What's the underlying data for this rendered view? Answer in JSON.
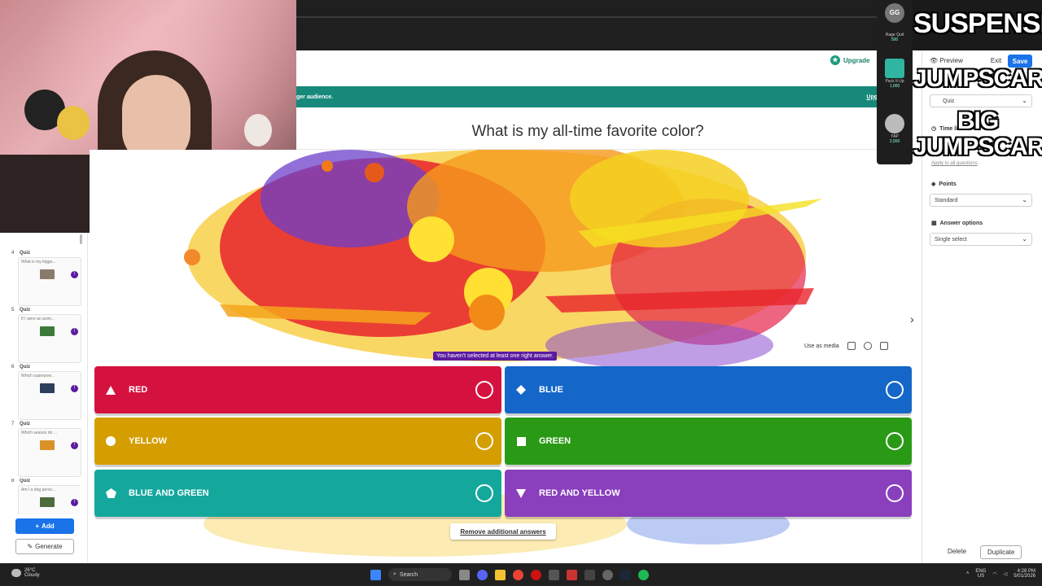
{
  "app": {
    "upgrade_label": "Upgrade",
    "banner_text": "ger audience.",
    "banner_link": "Upg"
  },
  "question": {
    "title": "What is my all-time favorite color?"
  },
  "media_tools": {
    "use_as_media": "Use as media"
  },
  "warning": "You haven't selected at least one right answer.",
  "answers": [
    {
      "label": "RED",
      "color": "#d5123f"
    },
    {
      "label": "BLUE",
      "color": "#1467c8"
    },
    {
      "label": "YELLOW",
      "color": "#d49e00"
    },
    {
      "label": "GREEN",
      "color": "#2a9a16"
    },
    {
      "label": "BLUE AND GREEN",
      "color": "#14a89d"
    },
    {
      "label": "RED AND YELLOW",
      "color": "#8a3fbd"
    }
  ],
  "remove_answers": "Remove additional answers",
  "right_panel": {
    "preview": "Preview",
    "exit": "Exit",
    "save": "Save",
    "quiz_type": "Quiz",
    "time_limit_label": "Time li",
    "apply_all": "Apply to all questions",
    "points_label": "Points",
    "points_value": "Standard",
    "answer_options_label": "Answer options",
    "answer_options_value": "Single select",
    "delete": "Delete",
    "duplicate": "Duplicate"
  },
  "overlay": {
    "line1": "SUSPENSE",
    "line2": "JUMPSCARE",
    "line3": "BIG",
    "line4": "JUMPSCARE"
  },
  "alerts": [
    {
      "name": "Rage Quit",
      "cost": "500"
    },
    {
      "name": "Pack It Up",
      "cost": "1,000"
    },
    {
      "name": "YAP",
      "cost": "2,000"
    }
  ],
  "alerts_header": "GG",
  "sidebar": {
    "slides": [
      {
        "num": "4",
        "type": "Quiz",
        "q": "What is my bigge..."
      },
      {
        "num": "5",
        "type": "Quiz",
        "q": "If I were an anim..."
      },
      {
        "num": "6",
        "type": "Quiz",
        "q": "Which superpow..."
      },
      {
        "num": "7",
        "type": "Quiz",
        "q": "Which season do ..."
      },
      {
        "num": "8",
        "type": "Quiz",
        "q": "Am I a dog perso..."
      }
    ],
    "add": "Add",
    "generate": "Generate"
  },
  "taskbar": {
    "temp": "26°C",
    "weather": "Cloudy",
    "search": "Search",
    "lang1": "ENG",
    "lang2": "US",
    "time": "4:28 PM",
    "date": "5/01/2026"
  }
}
